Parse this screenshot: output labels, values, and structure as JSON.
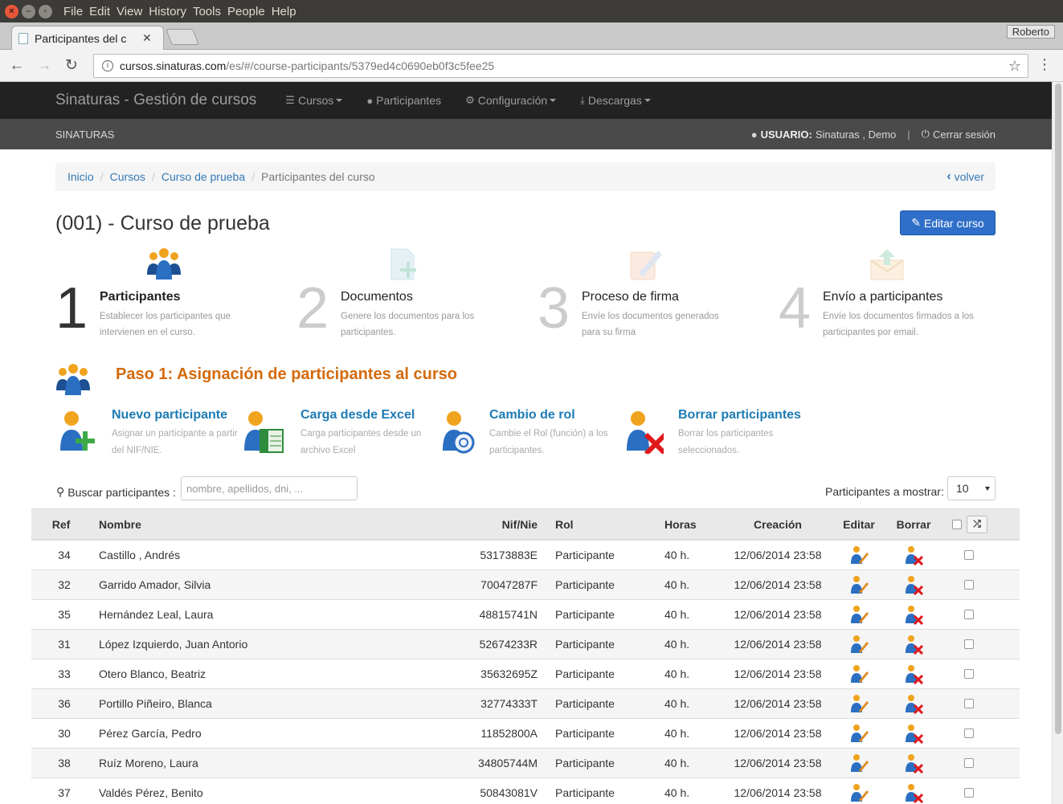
{
  "os": {
    "menu": [
      "File",
      "Edit",
      "View",
      "History",
      "Tools",
      "People",
      "Help"
    ]
  },
  "browser": {
    "tab_title": "Participantes del c",
    "profile": "Roberto",
    "url_host": "cursos.sinaturas.com",
    "url_path": "/es/#/course-participants/5379ed4c0690eb0f3c5fee25"
  },
  "navbar": {
    "brand": "Sinaturas - Gestión de cursos",
    "items": [
      "Cursos",
      "Participantes",
      "Configuración",
      "Descargas"
    ]
  },
  "subbar": {
    "org": "SINATURAS",
    "user_label": "USUARIO:",
    "user_name": "Sinaturas , Demo",
    "logout": "Cerrar sesión"
  },
  "breadcrumb": {
    "items": [
      "Inicio",
      "Cursos",
      "Curso de prueba",
      "Participantes del curso"
    ],
    "back": "volver"
  },
  "page": {
    "title": "(001) - Curso de prueba",
    "edit_button": "Editar curso"
  },
  "steps": [
    {
      "num": "1",
      "title": "Participantes",
      "desc": "Establecer los participantes que intervienen en el curso."
    },
    {
      "num": "2",
      "title": "Documentos",
      "desc": "Genere los documentos para los participantes."
    },
    {
      "num": "3",
      "title": "Proceso de firma",
      "desc": "Envíe los documentos generados para su firma"
    },
    {
      "num": "4",
      "title": "Envío a participantes",
      "desc": "Envíe los documentos firmados a los participantes por email."
    }
  ],
  "section": {
    "title": "Paso 1: Asignación de participantes al curso"
  },
  "actions": [
    {
      "title": "Nuevo participante",
      "desc": "Asignar un participante a partir del NIF/NIE."
    },
    {
      "title": "Carga desde Excel",
      "desc": "Carga participantes desde un archivo Excel"
    },
    {
      "title": "Cambio de rol",
      "desc": "Cambie el Rol (función) a los participantes."
    },
    {
      "title": "Borrar participantes",
      "desc": "Borrar los participantes seleccionados."
    }
  ],
  "search": {
    "label": "Buscar participantes :",
    "placeholder": "nombre, apellidos, dni, ...",
    "show_label": "Participantes a mostrar:",
    "show_value": "10"
  },
  "table": {
    "headers": {
      "ref": "Ref",
      "name": "Nombre",
      "nif": "Nif/Nie",
      "rol": "Rol",
      "horas": "Horas",
      "creacion": "Creación",
      "editar": "Editar",
      "borrar": "Borrar"
    },
    "rows": [
      {
        "ref": "34",
        "name": "Castillo , Andrés",
        "nif": "53173883E",
        "rol": "Participante",
        "horas": "40 h.",
        "creacion": "12/06/2014 23:58"
      },
      {
        "ref": "32",
        "name": "Garrido Amador, Silvia",
        "nif": "70047287F",
        "rol": "Participante",
        "horas": "40 h.",
        "creacion": "12/06/2014 23:58"
      },
      {
        "ref": "35",
        "name": "Hernández Leal, Laura",
        "nif": "48815741N",
        "rol": "Participante",
        "horas": "40 h.",
        "creacion": "12/06/2014 23:58"
      },
      {
        "ref": "31",
        "name": "López Izquierdo, Juan Antorio",
        "nif": "52674233R",
        "rol": "Participante",
        "horas": "40 h.",
        "creacion": "12/06/2014 23:58"
      },
      {
        "ref": "33",
        "name": "Otero Blanco, Beatriz",
        "nif": "35632695Z",
        "rol": "Participante",
        "horas": "40 h.",
        "creacion": "12/06/2014 23:58"
      },
      {
        "ref": "36",
        "name": "Portillo Piñeiro, Blanca",
        "nif": "32774333T",
        "rol": "Participante",
        "horas": "40 h.",
        "creacion": "12/06/2014 23:58"
      },
      {
        "ref": "30",
        "name": "Pérez García, Pedro",
        "nif": "11852800A",
        "rol": "Participante",
        "horas": "40 h.",
        "creacion": "12/06/2014 23:58"
      },
      {
        "ref": "38",
        "name": "Ruíz Moreno, Laura",
        "nif": "34805744M",
        "rol": "Participante",
        "horas": "40 h.",
        "creacion": "12/06/2014 23:58"
      },
      {
        "ref": "37",
        "name": "Valdés Pérez, Benito",
        "nif": "50843081V",
        "rol": "Participante",
        "horas": "40 h.",
        "creacion": "12/06/2014 23:58"
      }
    ]
  },
  "colors": {
    "accent": "#337ab7",
    "step_orange": "#d46a0b",
    "action_blue": "#1d7bb5",
    "navbar": "#222222",
    "edit_button": "#2f6fc9"
  }
}
